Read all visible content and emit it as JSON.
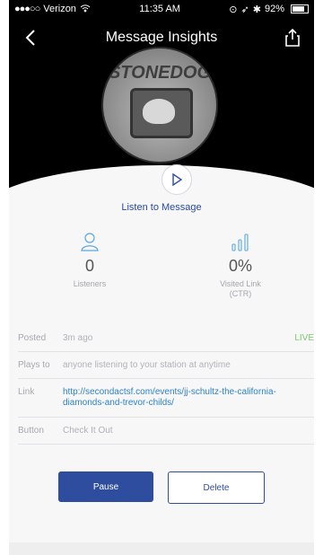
{
  "status_bar": {
    "carrier": "Verizon",
    "time": "11:35 AM",
    "battery": "92%"
  },
  "header": {
    "title": "Message Insights"
  },
  "media": {
    "listen_label": "Listen to Message"
  },
  "stats": {
    "listeners": {
      "value": "0",
      "label": "Listeners"
    },
    "ctr": {
      "value": "0%",
      "label_line1": "Visited Link",
      "label_line2": "(CTR)"
    }
  },
  "rows": {
    "posted": {
      "label": "Posted",
      "value": "3m ago",
      "badge": "LIVE"
    },
    "plays_to": {
      "label": "Plays to",
      "value": "anyone listening to your station at anytime"
    },
    "link": {
      "label": "Link",
      "value": "http://secondactsf.com/events/jj-schultz-the-california-diamonds-and-trevor-childs/"
    },
    "button": {
      "label": "Button",
      "value": "Check It Out"
    }
  },
  "actions": {
    "pause_label": "Pause",
    "delete_label": "Delete"
  },
  "colors": {
    "accent": "#2f4d9e",
    "link": "#2a83c9",
    "live": "#7acb6e"
  }
}
